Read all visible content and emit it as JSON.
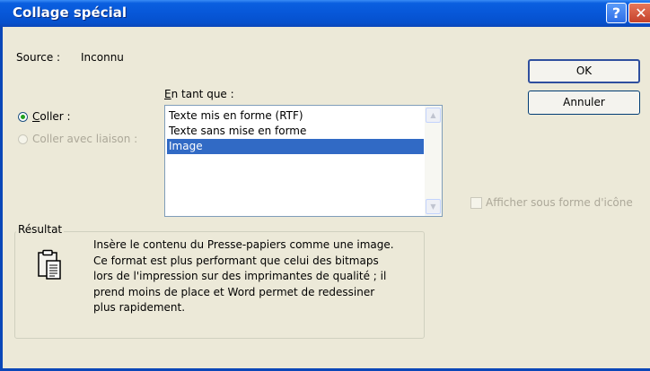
{
  "window": {
    "title": "Collage spécial"
  },
  "titlebar_buttons": {
    "help_label": "?",
    "close_label": "✕"
  },
  "source": {
    "label": "Source :",
    "value": "Inconnu"
  },
  "buttons": {
    "ok_label": "OK",
    "cancel_label": "Annuler"
  },
  "paste_as": {
    "label_accel": "E",
    "label_rest": "n tant que :"
  },
  "radios": {
    "paste_accel": "C",
    "paste_rest": "oller :",
    "paste_checked": true,
    "link_label": "Coller avec liaison :",
    "link_enabled": false
  },
  "list": {
    "items": [
      "Texte mis en forme (RTF)",
      "Texte sans mise en forme",
      "Image"
    ],
    "selected_index": 2
  },
  "display_as_icon": {
    "label": "Afficher sous forme d'icône",
    "checked": false,
    "enabled": false
  },
  "result": {
    "legend": "Résultat",
    "lines": [
      "Insère le contenu du Presse-papiers comme une image.",
      "Ce format est plus performant que celui des bitmaps",
      "lors de l'impression sur des imprimantes de qualité ; il",
      "prend moins de place et Word permet de redessiner",
      "plus rapidement."
    ],
    "icon": "clipboard-icon"
  },
  "colors": {
    "titlebar": "#0757D8",
    "dialog_bg": "#ECE9D8",
    "selection": "#316AC5",
    "disabled_text": "#ACA899"
  }
}
